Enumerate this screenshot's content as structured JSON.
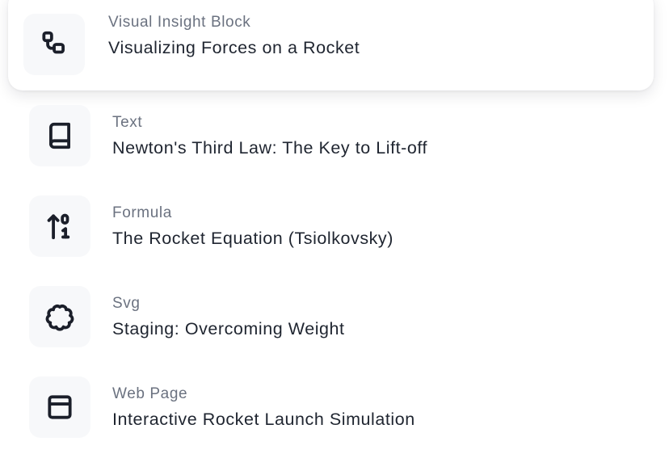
{
  "items": [
    {
      "type": "Visual Insight Block",
      "title": "Visualizing Forces on a Rocket",
      "icon": "workflow-icon",
      "selected": true
    },
    {
      "type": "Text",
      "title": "Newton's Third Law: The Key to Lift-off",
      "icon": "book-icon",
      "selected": false
    },
    {
      "type": "Formula",
      "title": "The Rocket Equation (Tsiolkovsky)",
      "icon": "arrow-up-01-icon",
      "selected": false
    },
    {
      "type": "Svg",
      "title": "Staging: Overcoming Weight",
      "icon": "flower-icon",
      "selected": false
    },
    {
      "type": "Web Page",
      "title": "Interactive Rocket Launch Simulation",
      "icon": "panel-top-icon",
      "selected": false
    }
  ],
  "colors": {
    "icon_box_bg": "#f7f8fa",
    "type_text": "#6b7280",
    "title_text": "#1f2530",
    "icon_stroke": "#1b1f2a"
  }
}
